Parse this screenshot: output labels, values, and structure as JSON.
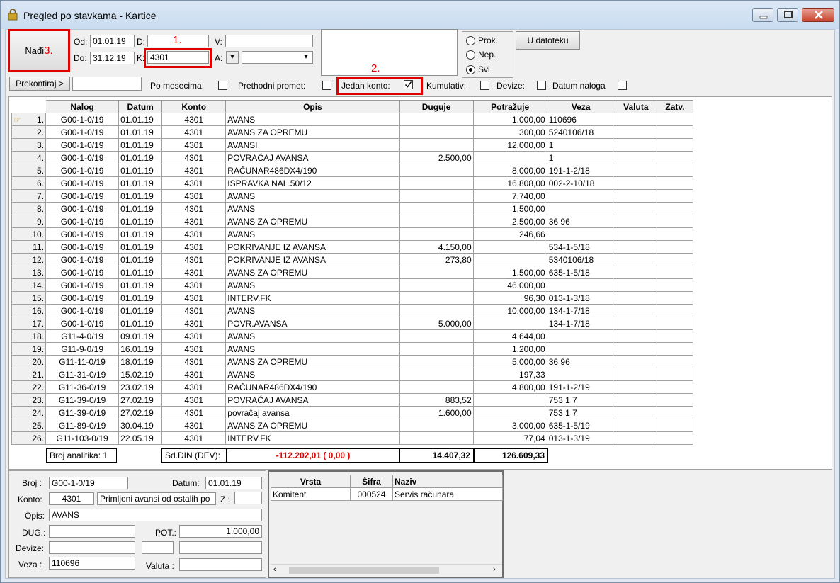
{
  "window": {
    "title": "Pregled po stavkama - Kartice"
  },
  "filters": {
    "find_label": "Nađi",
    "od_label": "Od:",
    "od_value": "01.01.19",
    "do_label": "Do:",
    "do_value": "31.12.19",
    "d_label": "D:",
    "d_value": "",
    "k_label": "K:",
    "k_value": "4301",
    "v_label": "V:",
    "v_value": "",
    "a_label": "A:",
    "a_value": "",
    "radio_prok": "Prok.",
    "radio_nep": "Nep.",
    "radio_svi": "Svi",
    "file_button": "U datoteku",
    "prekontiraj_button": "Prekontiraj >",
    "po_mesecima": "Po mesecima:",
    "prethodni_promet": "Prethodni promet:",
    "jedan_konto": "Jedan konto:",
    "kumulativ": "Kumulativ:",
    "devize": "Devize:",
    "datum_naloga": "Datum naloga"
  },
  "annotations": {
    "one": "1.",
    "two": "2.",
    "three": "3."
  },
  "grid": {
    "headers": [
      "Nalog",
      "Datum",
      "Konto",
      "Opis",
      "Duguje",
      "Potražuje",
      "Veza",
      "Valuta",
      "Zatv."
    ],
    "rows": [
      [
        "1.",
        "G00-1-0/19",
        "01.01.19",
        "4301",
        "AVANS",
        "",
        "1.000,00",
        "110696"
      ],
      [
        "2.",
        "G00-1-0/19",
        "01.01.19",
        "4301",
        "AVANS ZA OPREMU",
        "",
        "300,00",
        "5240106/18"
      ],
      [
        "3.",
        "G00-1-0/19",
        "01.01.19",
        "4301",
        "AVANSI",
        "",
        "12.000,00",
        "1"
      ],
      [
        "4.",
        "G00-1-0/19",
        "01.01.19",
        "4301",
        "POVRAĆAJ AVANSA",
        "2.500,00",
        "",
        "1"
      ],
      [
        "5.",
        "G00-1-0/19",
        "01.01.19",
        "4301",
        "RAČUNAR486DX4/190",
        "",
        "8.000,00",
        "191-1-2/18"
      ],
      [
        "6.",
        "G00-1-0/19",
        "01.01.19",
        "4301",
        "ISPRAVKA NAL.50/12",
        "",
        "16.808,00",
        "002-2-10/18"
      ],
      [
        "7.",
        "G00-1-0/19",
        "01.01.19",
        "4301",
        "AVANS",
        "",
        "7.740,00",
        ""
      ],
      [
        "8.",
        "G00-1-0/19",
        "01.01.19",
        "4301",
        "AVANS",
        "",
        "1.500,00",
        ""
      ],
      [
        "9.",
        "G00-1-0/19",
        "01.01.19",
        "4301",
        "AVANS ZA OPREMU",
        "",
        "2.500,00",
        "36 96"
      ],
      [
        "10.",
        "G00-1-0/19",
        "01.01.19",
        "4301",
        "AVANS",
        "",
        "246,66",
        ""
      ],
      [
        "11.",
        "G00-1-0/19",
        "01.01.19",
        "4301",
        "POKRIVANJE IZ AVANSA",
        "4.150,00",
        "",
        "534-1-5/18"
      ],
      [
        "12.",
        "G00-1-0/19",
        "01.01.19",
        "4301",
        "POKRIVANJE IZ AVANSA",
        "273,80",
        "",
        "5340106/18"
      ],
      [
        "13.",
        "G00-1-0/19",
        "01.01.19",
        "4301",
        "AVANS ZA OPREMU",
        "",
        "1.500,00",
        "635-1-5/18"
      ],
      [
        "14.",
        "G00-1-0/19",
        "01.01.19",
        "4301",
        "AVANS",
        "",
        "46.000,00",
        ""
      ],
      [
        "15.",
        "G00-1-0/19",
        "01.01.19",
        "4301",
        "INTERV.FK",
        "",
        "96,30",
        "013-1-3/18"
      ],
      [
        "16.",
        "G00-1-0/19",
        "01.01.19",
        "4301",
        "AVANS",
        "",
        "10.000,00",
        "134-1-7/18"
      ],
      [
        "17.",
        "G00-1-0/19",
        "01.01.19",
        "4301",
        "POVR.AVANSA",
        "5.000,00",
        "",
        "134-1-7/18"
      ],
      [
        "18.",
        "G11-4-0/19",
        "09.01.19",
        "4301",
        "AVANS",
        "",
        "4.644,00",
        ""
      ],
      [
        "19.",
        "G11-9-0/19",
        "16.01.19",
        "4301",
        "AVANS",
        "",
        "1.200,00",
        ""
      ],
      [
        "20.",
        "G11-11-0/19",
        "18.01.19",
        "4301",
        "AVANS ZA OPREMU",
        "",
        "5.000,00",
        "36 96"
      ],
      [
        "21.",
        "G11-31-0/19",
        "15.02.19",
        "4301",
        "AVANS",
        "",
        "197,33",
        ""
      ],
      [
        "22.",
        "G11-36-0/19",
        "23.02.19",
        "4301",
        "RAČUNAR486DX4/190",
        "",
        "4.800,00",
        "191-1-2/19"
      ],
      [
        "23.",
        "G11-39-0/19",
        "27.02.19",
        "4301",
        "POVRAĆAJ AVANSA",
        "883,52",
        "",
        "753 1 7"
      ],
      [
        "24.",
        "G11-39-0/19",
        "27.02.19",
        "4301",
        "povraĉaj avansa",
        "1.600,00",
        "",
        "753 1 7"
      ],
      [
        "25.",
        "G11-89-0/19",
        "30.04.19",
        "4301",
        "AVANS ZA OPREMU",
        "",
        "3.000,00",
        "635-1-5/19"
      ],
      [
        "26.",
        "G11-103-0/19",
        "22.05.19",
        "4301",
        "INTERV.FK",
        "",
        "77,04",
        "013-1-3/19"
      ]
    ]
  },
  "summary": {
    "broj_analitika": "Broj analitika: 1",
    "sd_label": "Sd.DIN (DEV):",
    "saldo": "-112.202,01   ( 0,00 )",
    "duguje_total": "14.407,32",
    "potrazuje_total": "126.609,33"
  },
  "detail": {
    "broj_label": "Broj :",
    "broj_value": "G00-1-0/19",
    "datum_label": "Datum:",
    "datum_value": "01.01.19",
    "konto_label": "Konto:",
    "konto_value": "4301",
    "konto_name": "Primljeni avansi od ostalih po",
    "z_label": "Z :",
    "z_value": "",
    "opis_label": "Opis:",
    "opis_value": "AVANS",
    "dug_label": "DUG.:",
    "dug_value": "",
    "pot_label": "POT.:",
    "pot_value": "1.000,00",
    "devize_label": "Devize:",
    "veza_label": "Veza :",
    "veza_value": "110696",
    "valuta_label": "Valuta :",
    "valuta_value": ""
  },
  "analytics": {
    "headers": [
      "Vrsta",
      "Šifra",
      "Naziv"
    ],
    "rows": [
      [
        "Komitent",
        "000524",
        "Servis računara"
      ]
    ]
  },
  "colors": {
    "annotation_red": "#e00000",
    "saldo_red": "#e00000"
  }
}
